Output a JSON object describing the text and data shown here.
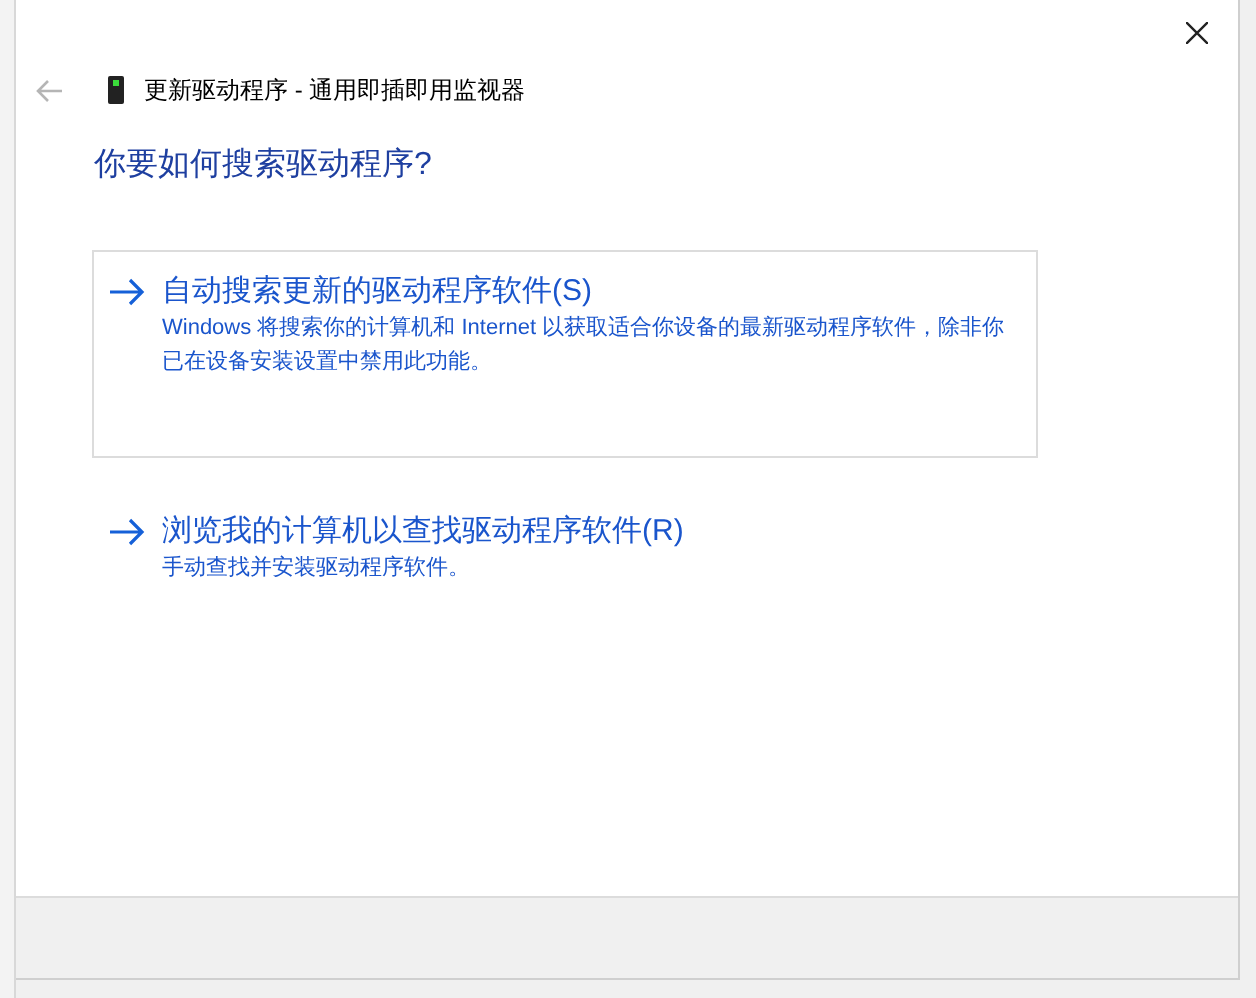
{
  "window": {
    "title": "更新驱动程序 - 通用即插即用监视器"
  },
  "heading": "你要如何搜索驱动程序?",
  "options": [
    {
      "title": "自动搜索更新的驱动程序软件(S)",
      "description": "Windows 将搜索你的计算机和 Internet 以获取适合你设备的最新驱动程序软件，除非你已在设备安装设置中禁用此功能。",
      "selected": true
    },
    {
      "title": "浏览我的计算机以查找驱动程序软件(R)",
      "description": "手动查找并安装驱动程序软件。",
      "selected": false
    }
  ]
}
